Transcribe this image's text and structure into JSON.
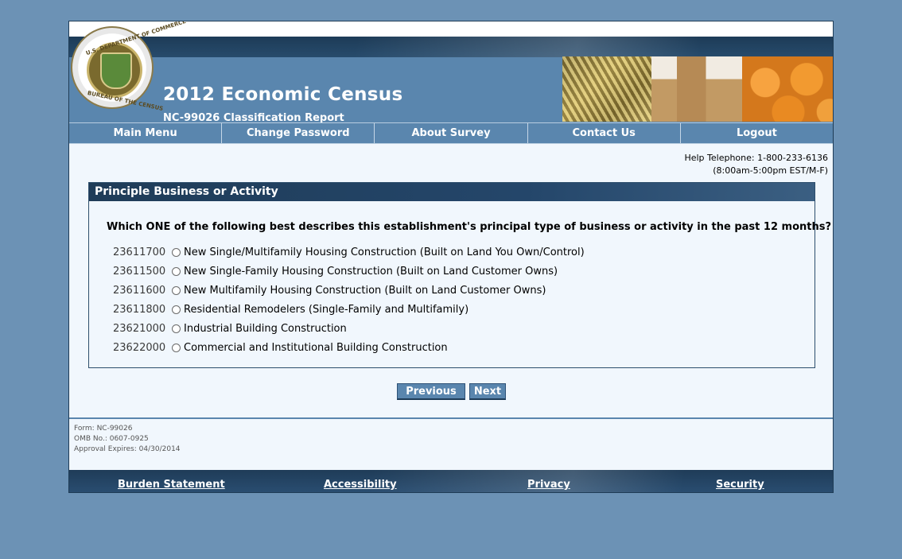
{
  "header": {
    "title": "2012 Economic Census",
    "subtitle": "NC-99026 Classification Report",
    "seal_top_text": "U.S. DEPARTMENT OF COMMERCE",
    "seal_bottom_text": "BUREAU OF THE CENSUS"
  },
  "nav": {
    "items": [
      "Main Menu",
      "Change Password",
      "About Survey",
      "Contact Us",
      "Logout"
    ]
  },
  "help": {
    "telephone": "Help Telephone: 1-800-233-6136",
    "hours": "(8:00am-5:00pm EST/M-F)"
  },
  "panel": {
    "title": "Principle Business or Activity",
    "question": "Which ONE of the following best describes this establishment's principal type of business or activity in the past 12 months?",
    "help_icon_glyph": "?",
    "options": [
      {
        "code": "23611700",
        "label": "New Single/Multifamily Housing Construction (Built on Land You Own/Control)"
      },
      {
        "code": "23611500",
        "label": "New Single-Family Housing Construction (Built on Land Customer Owns)"
      },
      {
        "code": "23611600",
        "label": "New Multifamily Housing Construction (Built on Land Customer Owns)"
      },
      {
        "code": "23611800",
        "label": "Residential Remodelers (Single-Family and Multifamily)"
      },
      {
        "code": "23621000",
        "label": "Industrial Building Construction"
      },
      {
        "code": "23622000",
        "label": "Commercial and Institutional Building Construction"
      }
    ]
  },
  "buttons": {
    "previous": "Previous",
    "next": "Next"
  },
  "form_info": {
    "form": "Form: NC-99026",
    "omb": "OMB No.: 0607-0925",
    "expires": "Approval Expires: 04/30/2014"
  },
  "footer": {
    "links": [
      "Burden Statement",
      "Accessibility",
      "Privacy",
      "Security"
    ]
  },
  "colors": {
    "page_background": "#6c92b5",
    "header_blue": "#5a86ae",
    "dark_navy": "#1f3c58",
    "content_background": "#f1f7fd"
  }
}
